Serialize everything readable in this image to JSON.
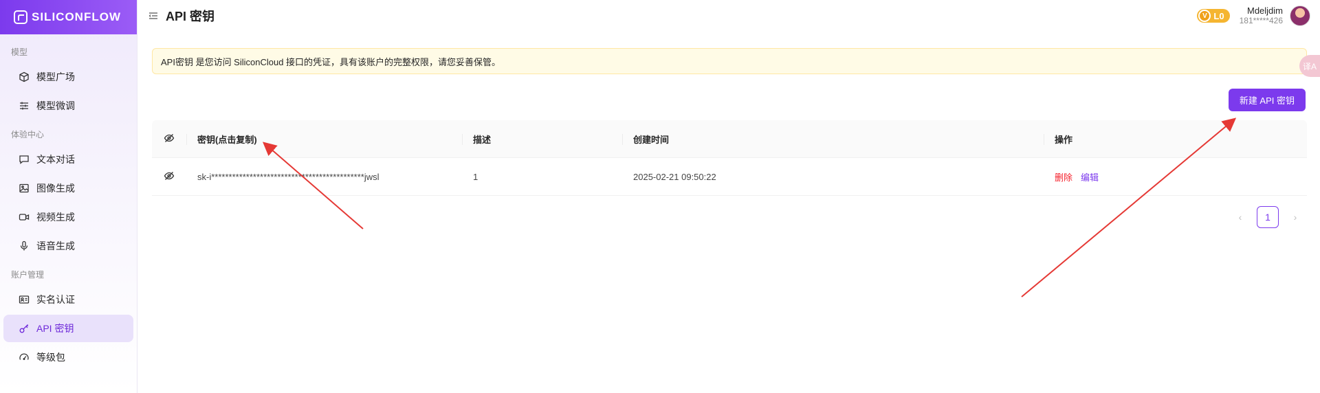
{
  "brand": {
    "name": "SILICONFLOW"
  },
  "sidebar": {
    "sections": [
      {
        "label": "模型"
      },
      {
        "label": "体验中心"
      },
      {
        "label": "账户管理"
      }
    ],
    "items": [
      {
        "label": "模型广场",
        "icon": "cube-icon"
      },
      {
        "label": "模型微调",
        "icon": "sliders-icon"
      },
      {
        "label": "文本对话",
        "icon": "chat-icon"
      },
      {
        "label": "图像生成",
        "icon": "image-icon"
      },
      {
        "label": "视频生成",
        "icon": "video-icon"
      },
      {
        "label": "语音生成",
        "icon": "microphone-icon"
      },
      {
        "label": "实名认证",
        "icon": "id-card-icon"
      },
      {
        "label": "API 密钥",
        "icon": "key-icon",
        "active": true
      },
      {
        "label": "等级包",
        "icon": "gauge-icon"
      }
    ]
  },
  "header": {
    "title": "API 密钥",
    "level": {
      "badge_letter": "V",
      "label": "L0"
    },
    "user": {
      "name": "Mdeljdim",
      "phone": "181*****426"
    }
  },
  "notice": {
    "text": "API密钥 是您访问 SiliconCloud 接口的凭证，具有该账户的完整权限，请您妥善保管。"
  },
  "side_tool": {
    "label": "译A"
  },
  "actions": {
    "new_key_label": "新建 API 密钥"
  },
  "table": {
    "columns": [
      "密钥(点击复制)",
      "描述",
      "创建时间",
      "操作"
    ],
    "rows": [
      {
        "key": "sk-i********************************************jwsl",
        "description": "1",
        "created": "2025-02-21 09:50:22",
        "delete_label": "删除",
        "edit_label": "编辑"
      }
    ]
  },
  "pagination": {
    "current": "1",
    "prev": "‹",
    "next": "›"
  },
  "colors": {
    "accent": "#7c3aed",
    "notice_bg": "#fffbe6",
    "danger": "#f5222d",
    "annotation": "#e53935"
  }
}
